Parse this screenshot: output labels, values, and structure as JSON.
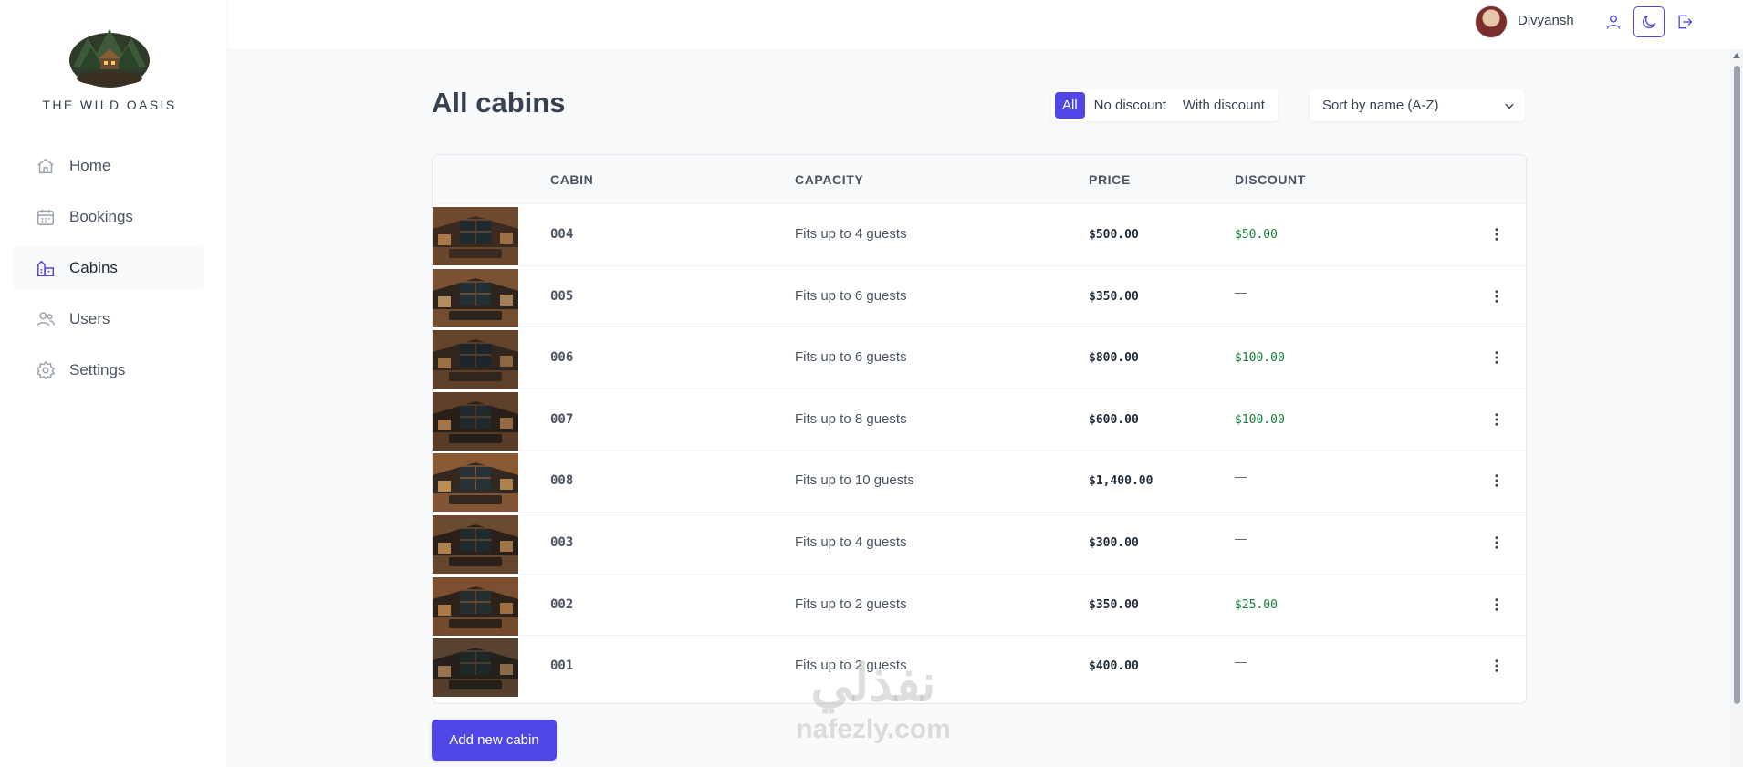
{
  "brand": {
    "name": "THE WILD OASIS"
  },
  "nav": {
    "items": [
      {
        "label": "Home",
        "icon": "home-icon",
        "active": false
      },
      {
        "label": "Bookings",
        "icon": "calendar-icon",
        "active": false
      },
      {
        "label": "Cabins",
        "icon": "cabins-icon",
        "active": true
      },
      {
        "label": "Users",
        "icon": "users-icon",
        "active": false
      },
      {
        "label": "Settings",
        "icon": "gear-icon",
        "active": false
      }
    ]
  },
  "header": {
    "username": "Divyansh",
    "buttons": [
      "user-icon",
      "moon-icon",
      "logout-icon"
    ]
  },
  "page": {
    "title": "All cabins",
    "filters": [
      "All",
      "No discount",
      "With discount"
    ],
    "active_filter": "All",
    "sort": {
      "selected": "Sort by name (A-Z)"
    }
  },
  "table": {
    "headers": {
      "cabin": "CABIN",
      "capacity": "CAPACITY",
      "price": "PRICE",
      "discount": "DISCOUNT"
    },
    "rows": [
      {
        "name": "004",
        "capacity": "Fits up to 4 guests",
        "price": "$500.00",
        "discount": "$50.00"
      },
      {
        "name": "005",
        "capacity": "Fits up to 6 guests",
        "price": "$350.00",
        "discount": "—"
      },
      {
        "name": "006",
        "capacity": "Fits up to 6 guests",
        "price": "$800.00",
        "discount": "$100.00"
      },
      {
        "name": "007",
        "capacity": "Fits up to 8 guests",
        "price": "$600.00",
        "discount": "$100.00"
      },
      {
        "name": "008",
        "capacity": "Fits up to 10 guests",
        "price": "$1,400.00",
        "discount": "—"
      },
      {
        "name": "003",
        "capacity": "Fits up to 4 guests",
        "price": "$300.00",
        "discount": "—"
      },
      {
        "name": "002",
        "capacity": "Fits up to 2 guests",
        "price": "$350.00",
        "discount": "$25.00"
      },
      {
        "name": "001",
        "capacity": "Fits up to 2 guests",
        "price": "$400.00",
        "discount": "—"
      }
    ]
  },
  "actions": {
    "add_label": "Add new cabin"
  },
  "watermark": {
    "line1": "نفذلي",
    "line2": "nafezly.com"
  },
  "colors": {
    "accent": "#4f46e5",
    "discount": "#15803d",
    "text": "#374151"
  }
}
